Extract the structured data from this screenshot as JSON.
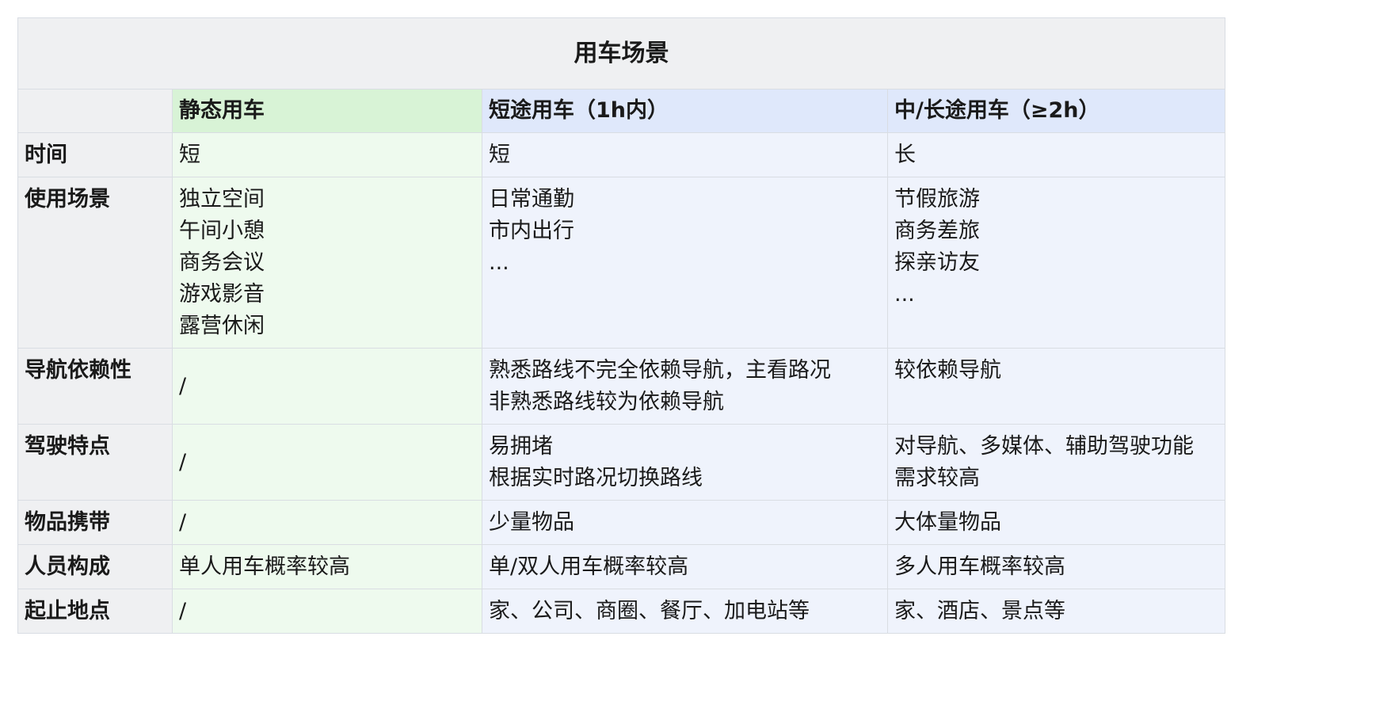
{
  "table": {
    "title": "用车场景",
    "columns": [
      "",
      "静态用车",
      "短途用车（1h内）",
      "中/长途用车（≥2h）"
    ],
    "rows": [
      {
        "label": "时间",
        "static": [
          "短"
        ],
        "short": [
          "短"
        ],
        "long": [
          "长"
        ]
      },
      {
        "label": "使用场景",
        "static": [
          "独立空间",
          "午间小憩",
          "商务会议",
          "游戏影音",
          "露营休闲"
        ],
        "short": [
          "日常通勤",
          "市内出行",
          "..."
        ],
        "long": [
          "节假旅游",
          "商务差旅",
          "探亲访友",
          "..."
        ]
      },
      {
        "label": "导航依赖性",
        "static": [
          "/"
        ],
        "short": [
          "熟悉路线不完全依赖导航，主看路况",
          "非熟悉路线较为依赖导航"
        ],
        "long": [
          "较依赖导航"
        ]
      },
      {
        "label": "驾驶特点",
        "static": [
          "/"
        ],
        "short": [
          "易拥堵",
          "根据实时路况切换路线"
        ],
        "long": [
          "对导航、多媒体、辅助驾驶功能",
          "需求较高"
        ]
      },
      {
        "label": "物品携带",
        "static": [
          "/"
        ],
        "short": [
          "少量物品"
        ],
        "long": [
          "大体量物品"
        ]
      },
      {
        "label": "人员构成",
        "static": [
          "单人用车概率较高"
        ],
        "short": [
          "单/双人用车概率较高"
        ],
        "long": [
          "多人用车概率较高"
        ]
      },
      {
        "label": "起止地点",
        "static": [
          "/"
        ],
        "short": [
          "家、公司、商圈、餐厅、加电站等"
        ],
        "long": [
          "家、酒店、景点等"
        ]
      }
    ]
  }
}
